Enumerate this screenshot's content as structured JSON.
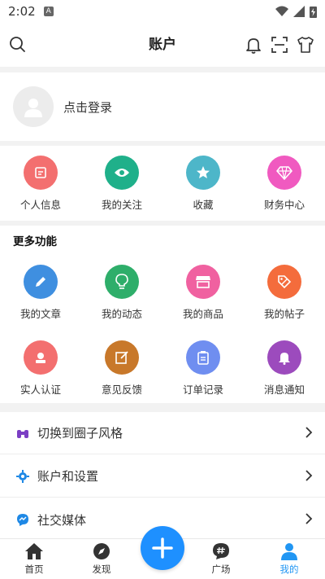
{
  "status_bar": {
    "time": "2:02",
    "notification_icon": "A"
  },
  "header": {
    "title": "账户"
  },
  "login": {
    "label": "点击登录"
  },
  "quick_actions": [
    {
      "label": "个人信息",
      "icon": "edit-icon",
      "color": "#f36f6f"
    },
    {
      "label": "我的关注",
      "icon": "eye-icon",
      "color": "#1fb08a"
    },
    {
      "label": "收藏",
      "icon": "star-icon",
      "color": "#4db6c9"
    },
    {
      "label": "财务中心",
      "icon": "diamond-icon",
      "color": "#f05ac0"
    }
  ],
  "more": {
    "heading": "更多功能",
    "items": [
      {
        "label": "我的文章",
        "icon": "pencil-icon",
        "color": "#3f8fe0"
      },
      {
        "label": "我的动态",
        "icon": "bulb-icon",
        "color": "#2eae6a"
      },
      {
        "label": "我的商品",
        "icon": "store-icon",
        "color": "#f061a0"
      },
      {
        "label": "我的帖子",
        "icon": "tag-icon",
        "color": "#f46c3c"
      },
      {
        "label": "实人认证",
        "icon": "user-badge-icon",
        "color": "#f36f6f"
      },
      {
        "label": "意见反馈",
        "icon": "feedback-icon",
        "color": "#c8782a"
      },
      {
        "label": "订单记录",
        "icon": "clipboard-icon",
        "color": "#6f8ef0"
      },
      {
        "label": "消息通知",
        "icon": "bell-icon",
        "color": "#9c4bbd"
      }
    ]
  },
  "list": [
    {
      "label": "切换到圈子风格",
      "icon": "binoculars-icon",
      "color": "#7b3fc4"
    },
    {
      "label": "账户和设置",
      "icon": "gear-icon",
      "color": "#1e88e5"
    },
    {
      "label": "社交媒体",
      "icon": "messenger-icon",
      "color": "#1e88e5"
    }
  ],
  "bottom_nav": {
    "items": [
      {
        "label": "首页",
        "icon": "home-icon"
      },
      {
        "label": "发现",
        "icon": "compass-icon"
      },
      {
        "label": "广场",
        "icon": "hash-chat-icon"
      },
      {
        "label": "我的",
        "icon": "person-icon"
      }
    ],
    "active": "我的",
    "accent": "#2196f3"
  }
}
